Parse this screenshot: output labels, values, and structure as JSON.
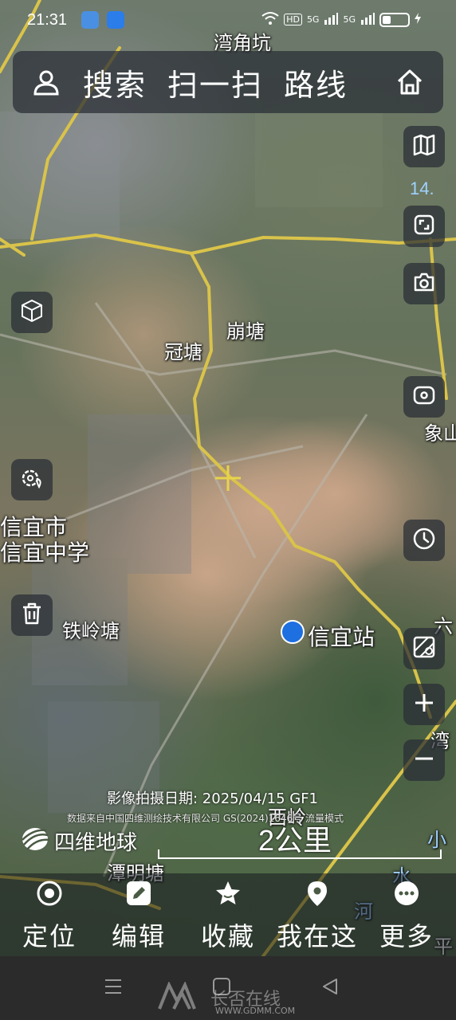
{
  "status_bar": {
    "time": "21:31",
    "network_hd": "HD",
    "signal_5g_1": "5G",
    "signal_5g_2": "5G"
  },
  "top_bar": {
    "search": "搜索",
    "scan": "扫一扫",
    "route": "路线"
  },
  "zoom_level": "14.",
  "map_labels": {
    "wanjiaokeng": "湾角坑",
    "bengtang": "崩塘",
    "guantang": "冠塘",
    "xinyi_city": "信宜市",
    "xinyi_school": "信宜中学",
    "tieling_tang": "铁岭塘",
    "xinyi_station": "信宜站",
    "xiang": "象山",
    "liu": "六",
    "wan": "湾",
    "xiao": "小",
    "shui": "水",
    "he": "河",
    "ping": "平",
    "tanming_tang": "潭明塘",
    "xiling": "西岭"
  },
  "capture_date": "影像拍摄日期:  2025/04/15 GF1",
  "data_source": "数据来自中国四维测绘技术有限公司 GS(2024)1646号 流量模式",
  "brand": "四维地球",
  "scale": "2公里",
  "bottom_nav": {
    "locate": "定位",
    "edit": "编辑",
    "favorite": "收藏",
    "here": "我在这",
    "more": "更多"
  },
  "watermark": {
    "text": "长否在线",
    "url": "WWW.GDMM.COM"
  },
  "colors": {
    "road": "#d9c34a",
    "panel": "#282c34",
    "accent_blue": "#9fd2ff",
    "station_blue": "#1e6fe0"
  }
}
